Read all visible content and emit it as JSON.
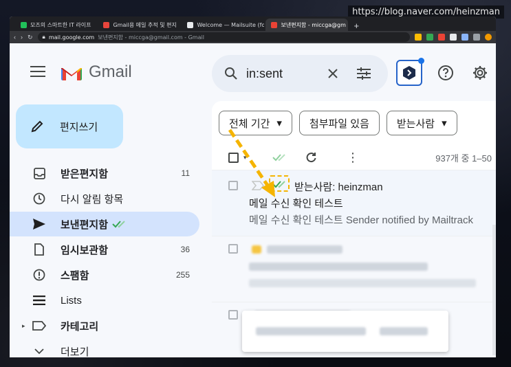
{
  "watermark": "https://blog.naver.com/heinzman",
  "browser": {
    "tabs": [
      {
        "label": "모즈의 스마트한 IT 라이프",
        "color": "#21c05a",
        "active": false
      },
      {
        "label": "Gmail용 메일 추적 및 편지",
        "color": "#e8453c",
        "active": false
      },
      {
        "label": "Welcome — Mailsuite (fo",
        "color": "#e8eaed",
        "active": false
      },
      {
        "label": "보낸편지함 - miccga@gm",
        "color": "#ea4335",
        "active": true
      }
    ],
    "new_tab": "+",
    "url_host": "mail.google.com",
    "url_rest": "보낸편지함 - miccga@gmail.com - Gmail"
  },
  "gmail": {
    "logo_text": "Gmail",
    "search_value": "in:sent",
    "compose_label": "편지쓰기",
    "nav": [
      {
        "label": "받은편지함",
        "count": "11",
        "icon": "inbox-icon",
        "bold": true
      },
      {
        "label": "다시 알림 항목",
        "count": "",
        "icon": "clock-icon",
        "bold": false
      },
      {
        "label": "보낸편지함",
        "count": "",
        "icon": "send-icon",
        "bold": true,
        "active": true
      },
      {
        "label": "임시보관함",
        "count": "36",
        "icon": "draft-icon",
        "bold": true
      },
      {
        "label": "스팸함",
        "count": "255",
        "icon": "spam-icon",
        "bold": true
      },
      {
        "label": "Lists",
        "count": "",
        "icon": "lists-icon",
        "bold": false
      },
      {
        "label": "카테고리",
        "count": "",
        "icon": "label-icon",
        "bold": true
      },
      {
        "label": "더보기",
        "count": "",
        "icon": "chevron-down-icon",
        "bold": false
      }
    ],
    "filters": [
      {
        "label": "전체 기간",
        "dropdown": true
      },
      {
        "label": "첨부파일 있음",
        "dropdown": false
      },
      {
        "label": "받는사람",
        "dropdown": true
      }
    ],
    "pager": "937개 중 1–50",
    "email": {
      "recipient": "받는사람: heinzman",
      "subject": "메일 수신 확인 테스트",
      "snippet": "메일 수신 확인 테스트 Sender notified by Mailtrack"
    }
  },
  "colors": {
    "accent": "#0b57d0",
    "compose": "#c2e7ff",
    "active_nav": "#d3e3fd",
    "highlight": "#f5b400",
    "tracker_check": "#34a853"
  }
}
